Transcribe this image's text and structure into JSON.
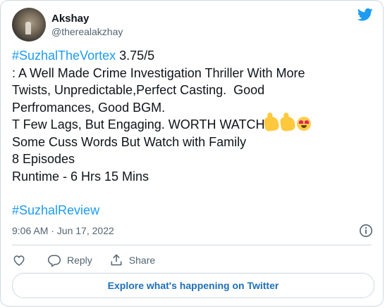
{
  "author": {
    "display_name": "Akshay",
    "handle": "@therealakzhay"
  },
  "tweet": {
    "hashtag_title": "#SuzhalTheVortex",
    "rating": " 3.75/5",
    "line_2": ": A Well Made Crime Investigation Thriller With More",
    "line_3": "Twists, Unpredictable,Perfect Casting.  Good",
    "line_4": "Perfromances, Good BGM.",
    "line_5": "T Few Lags, But Engaging. WORTH WATCH",
    "line_6": "Some Cuss Words But Watch with Family",
    "line_7": "8 Episodes",
    "line_8": "Runtime - 6 Hrs 15 Mins",
    "hashtag_review": "#SuzhalReview",
    "emojis": [
      "thumbs-up",
      "thumbs-up",
      "heart-eyes"
    ]
  },
  "meta": {
    "timestamp": "9:06 AM · Jun 17, 2022"
  },
  "actions": {
    "reply_label": "Reply",
    "share_label": "Share"
  },
  "footer": {
    "explore_label": "Explore what's happening on Twitter"
  },
  "colors": {
    "accent": "#1d9bf0",
    "text": "#0f1419",
    "secondary": "#536471",
    "border": "#cfd9de"
  },
  "icons": {
    "logo": "twitter-bird-icon",
    "info": "info-icon",
    "like": "heart-icon",
    "reply": "reply-bubble-icon",
    "share": "share-icon"
  }
}
